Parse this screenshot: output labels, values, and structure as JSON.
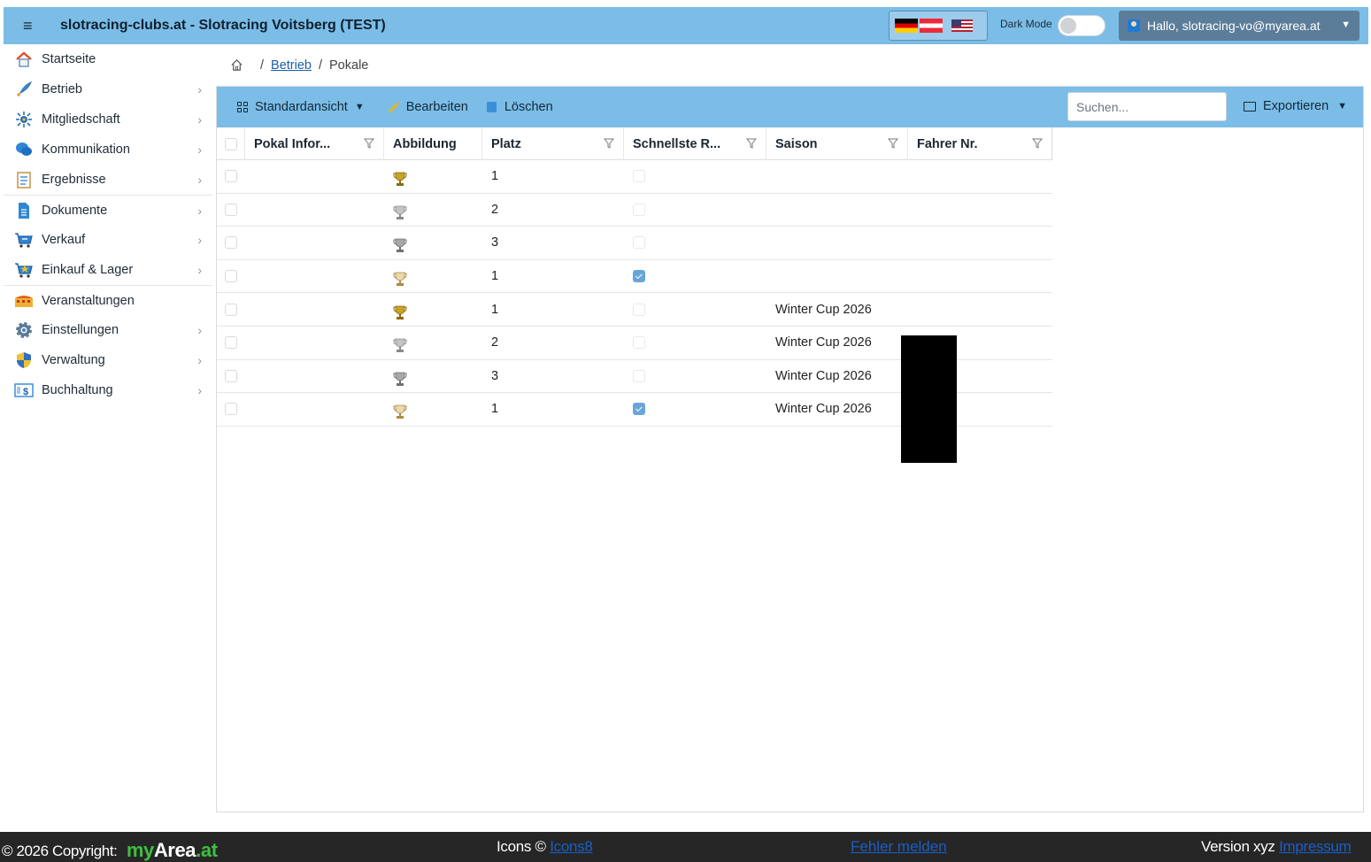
{
  "topbar": {
    "menu_icon": "hamburger-icon",
    "title": "slotracing-clubs.at - Slotracing Voitsberg (TEST)",
    "flags": [
      "de-flag",
      "at-flag",
      "us-flag"
    ],
    "dark_mode_label": "Dark Mode",
    "dark_mode_on": false,
    "user_label": "Hallo, slotracing-vo@myarea.at"
  },
  "sidebar": {
    "items": [
      {
        "label": "Startseite",
        "icon": "home-icon",
        "has_children": false
      },
      {
        "label": "Betrieb",
        "icon": "rocket-icon",
        "has_children": true
      },
      {
        "label": "Mitgliedschaft",
        "icon": "network-icon",
        "has_children": true
      },
      {
        "label": "Kommunikation",
        "icon": "chat-icon",
        "has_children": true
      },
      {
        "label": "Ergebnisse",
        "icon": "results-icon",
        "has_children": true
      },
      {
        "label": "Dokumente",
        "icon": "document-icon",
        "has_children": true
      },
      {
        "label": "Verkauf",
        "icon": "cart-icon",
        "has_children": true
      },
      {
        "label": "Einkauf & Lager",
        "icon": "cart-star-icon",
        "has_children": true
      },
      {
        "label": "Veranstaltungen",
        "icon": "stadium-icon",
        "has_children": false
      },
      {
        "label": "Einstellungen",
        "icon": "gear-icon",
        "has_children": true
      },
      {
        "label": "Verwaltung",
        "icon": "shield-icon",
        "has_children": true
      },
      {
        "label": "Buchhaltung",
        "icon": "accounting-icon",
        "has_children": true
      }
    ]
  },
  "breadcrumb": {
    "home_icon": "home-outline-icon",
    "parent": "Betrieb",
    "current": "Pokale",
    "separator": "/"
  },
  "toolbar": {
    "view_label": "Standardansicht",
    "edit_label": "Bearbeiten",
    "delete_label": "Löschen",
    "search_placeholder": "Suchen...",
    "export_label": "Exportieren"
  },
  "table": {
    "columns": [
      {
        "label": "Pokal Infor...",
        "filter": true
      },
      {
        "label": "Abbildung",
        "filter": false
      },
      {
        "label": "Platz",
        "filter": true
      },
      {
        "label": "Schnellste R...",
        "filter": true
      },
      {
        "label": "Saison",
        "filter": true
      },
      {
        "label": "Fahrer Nr.",
        "filter": true
      }
    ],
    "rows": [
      {
        "pokal": "",
        "trophy": "gold-trophy-icon",
        "platz": "1",
        "schnellste": false,
        "saison": "",
        "fahrer": ""
      },
      {
        "pokal": "",
        "trophy": "silver-trophy-icon",
        "platz": "2",
        "schnellste": false,
        "saison": "",
        "fahrer": ""
      },
      {
        "pokal": "",
        "trophy": "bronze-trophy-icon",
        "platz": "3",
        "schnellste": false,
        "saison": "",
        "fahrer": ""
      },
      {
        "pokal": "",
        "trophy": "fastest-trophy-icon",
        "platz": "1",
        "schnellste": true,
        "saison": "",
        "fahrer": ""
      },
      {
        "pokal": "",
        "trophy": "gold-trophy-icon",
        "platz": "1",
        "schnellste": false,
        "saison": "Winter Cup 2026",
        "fahrer": ""
      },
      {
        "pokal": "",
        "trophy": "silver-trophy-icon",
        "platz": "2",
        "schnellste": false,
        "saison": "Winter Cup 2026",
        "fahrer": ""
      },
      {
        "pokal": "",
        "trophy": "bronze-trophy-icon",
        "platz": "3",
        "schnellste": false,
        "saison": "Winter Cup 2026",
        "fahrer": ""
      },
      {
        "pokal": "",
        "trophy": "fastest-trophy-icon",
        "platz": "1",
        "schnellste": true,
        "saison": "Winter Cup 2026",
        "fahrer": ""
      }
    ]
  },
  "footer": {
    "copyright": "© 2026 Copyright:",
    "brand_my": "my",
    "brand_area": "Area",
    "brand_at": ".at",
    "icons_prefix": "Icons ©",
    "icons_link": "Icons8",
    "report_link": "Fehler melden",
    "version": "Version xyz",
    "impressum_link": "Impressum"
  },
  "colors": {
    "topbar_bg": "#7bbde6",
    "user_button_bg": "#5c7d99",
    "footer_bg": "#262626",
    "link": "#1d5fae",
    "checkbox_checked": "#6aa5da",
    "gold": "#c9a227",
    "silver": "#b9b9b9",
    "bronze": "#a0a0a0"
  }
}
